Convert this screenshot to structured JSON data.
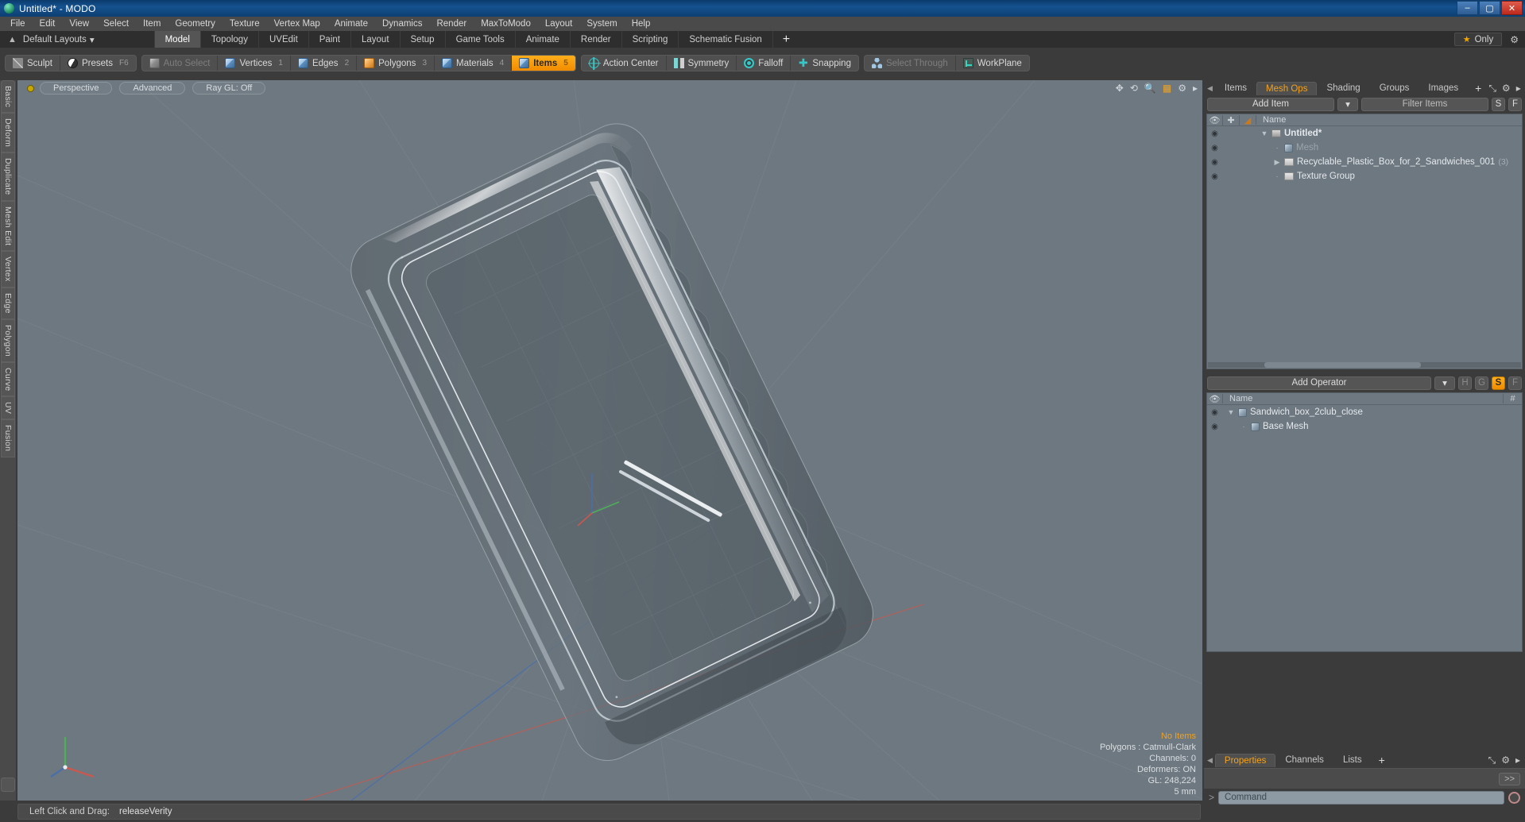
{
  "window": {
    "title": "Untitled* - MODO",
    "app_icon": "modo-logo-icon",
    "minimize": "–",
    "maximize": "▢",
    "close": "✕"
  },
  "menubar": {
    "items": [
      "File",
      "Edit",
      "View",
      "Select",
      "Item",
      "Geometry",
      "Texture",
      "Vertex Map",
      "Animate",
      "Dynamics",
      "Render",
      "MaxToModo",
      "Layout",
      "System",
      "Help"
    ]
  },
  "layoutrow": {
    "tree_icon": "tree-icon",
    "default_layouts": "Default Layouts",
    "dropdown_caret": "▾",
    "tabs": [
      {
        "label": "Model",
        "active": true
      },
      {
        "label": "Topology",
        "active": false
      },
      {
        "label": "UVEdit",
        "active": false
      },
      {
        "label": "Paint",
        "active": false
      },
      {
        "label": "Layout",
        "active": false
      },
      {
        "label": "Setup",
        "active": false
      },
      {
        "label": "Game Tools",
        "active": false
      },
      {
        "label": "Animate",
        "active": false
      },
      {
        "label": "Render",
        "active": false
      },
      {
        "label": "Scripting",
        "active": false
      },
      {
        "label": "Schematic Fusion",
        "active": false
      }
    ],
    "add_tab": "+",
    "only_label": "Only",
    "star_icon": "star-icon",
    "gear_icon": "gear-icon"
  },
  "modebar": {
    "groups": [
      {
        "buttons": [
          {
            "label": "Sculpt",
            "icon": "pen-icon",
            "state": "normal",
            "hot": ""
          },
          {
            "label": "Presets",
            "icon": "sphere-icon",
            "state": "normal",
            "hot": "F6"
          }
        ]
      },
      {
        "buttons": [
          {
            "label": "Auto Select",
            "icon": "grey-cube-icon",
            "state": "dim",
            "hot": ""
          },
          {
            "label": "Vertices",
            "icon": "blue-cube-icon",
            "state": "normal",
            "hot": "1"
          },
          {
            "label": "Edges",
            "icon": "blue-cube-icon",
            "state": "normal",
            "hot": "2"
          },
          {
            "label": "Polygons",
            "icon": "orange-cube-icon",
            "state": "normal",
            "hot": "3"
          },
          {
            "label": "Materials",
            "icon": "blue-cube-icon",
            "state": "normal",
            "hot": "4"
          },
          {
            "label": "Items",
            "icon": "blue-cube-icon",
            "state": "active",
            "hot": "5"
          }
        ]
      },
      {
        "buttons": [
          {
            "label": "Action Center",
            "icon": "target-icon",
            "state": "normal",
            "hot": ""
          },
          {
            "label": "Symmetry",
            "icon": "symmetry-icon",
            "state": "normal",
            "hot": ""
          },
          {
            "label": "Falloff",
            "icon": "falloff-icon",
            "state": "normal",
            "hot": ""
          },
          {
            "label": "Snapping",
            "icon": "snap-icon",
            "state": "normal",
            "hot": ""
          }
        ]
      },
      {
        "buttons": [
          {
            "label": "Select Through",
            "icon": "nodes-icon",
            "state": "dim",
            "hot": ""
          },
          {
            "label": "WorkPlane",
            "icon": "workplane-icon",
            "state": "normal",
            "hot": ""
          }
        ]
      }
    ]
  },
  "left_strip": {
    "tabs": [
      "Basic",
      "Deform",
      "Duplicate",
      "Mesh Edit",
      "Vertex",
      "Edge",
      "Polygon",
      "Curve",
      "UV",
      "Fusion"
    ]
  },
  "viewport": {
    "indicator_icon": "record-dot-icon",
    "pills": [
      "Perspective",
      "Advanced",
      "Ray GL: Off"
    ],
    "header_icons": [
      "move-icon",
      "rotate-icon",
      "zoom-icon",
      "grid-icon",
      "gear-icon",
      "chevron-right-icon"
    ],
    "stats": {
      "selection": "No Items",
      "polygons": "Polygons : Catmull-Clark",
      "channels": "Channels: 0",
      "deformers": "Deformers: ON",
      "gl": "GL: 248,224",
      "scale": "5 mm"
    },
    "axis_gizmo": "axis-gizmo-icon",
    "colors": {
      "x_axis": "#c9584f",
      "y_axis": "#3f7fd6",
      "z_axis": "#4fae5a",
      "background": "#6e7880"
    }
  },
  "item_panel": {
    "tabs": [
      {
        "label": "Items",
        "active": false
      },
      {
        "label": "Mesh Ops",
        "active": true
      },
      {
        "label": "Shading",
        "active": false
      },
      {
        "label": "Groups",
        "active": false
      },
      {
        "label": "Images",
        "active": false
      }
    ],
    "add_tab": "+",
    "tools": [
      "expand-icon",
      "gear-icon",
      "chevron-right-icon"
    ],
    "add_item_label": "Add Item",
    "add_item_caret": "▾",
    "filter_placeholder": "Filter Items",
    "btn_s": "S",
    "btn_f": "F",
    "columns": {
      "eye": "eye-icon",
      "lock": "lock-icon",
      "shade": "shade-icon",
      "name": "Name"
    },
    "rows": [
      {
        "name": "Untitled*",
        "icon": "scene-icon",
        "indent": 0,
        "twisty": "▼",
        "bold": true,
        "dim": false,
        "count": ""
      },
      {
        "name": "Mesh",
        "icon": "mesh-cube-icon",
        "indent": 1,
        "twisty": "",
        "bold": false,
        "dim": true,
        "count": ""
      },
      {
        "name": "Recyclable_Plastic_Box_for_2_Sandwiches_001",
        "icon": "folder-icon",
        "indent": 1,
        "twisty": "▶",
        "bold": false,
        "dim": false,
        "count": "(3)"
      },
      {
        "name": "Texture Group",
        "icon": "folder-icon",
        "indent": 1,
        "twisty": "",
        "bold": false,
        "dim": false,
        "count": ""
      }
    ]
  },
  "meshops_panel": {
    "add_operator_label": "Add Operator",
    "add_operator_caret": "▾",
    "buttons": [
      {
        "label": "H",
        "active": false
      },
      {
        "label": "G",
        "active": false
      },
      {
        "label": "S",
        "active": true
      },
      {
        "label": "F",
        "active": false
      }
    ],
    "columns": {
      "eye": "eye-icon",
      "name": "Name",
      "hash": "#"
    },
    "rows": [
      {
        "name": "Sandwich_box_2club_close",
        "icon": "mesh-cube-icon",
        "indent": 0,
        "twisty": "▼"
      },
      {
        "name": "Base Mesh",
        "icon": "mesh-cube-icon",
        "indent": 1,
        "twisty": ""
      }
    ]
  },
  "properties_panel": {
    "tabs": [
      {
        "label": "Properties",
        "active": true
      },
      {
        "label": "Channels",
        "active": false
      },
      {
        "label": "Lists",
        "active": false
      }
    ],
    "add_tab": "+",
    "tools": [
      "expand-icon",
      "gear-icon",
      "chevron-right-icon"
    ],
    "forward_button": ">>"
  },
  "command_bar": {
    "prompt": ">",
    "placeholder": "Command",
    "record_icon": "record-icon"
  },
  "statusbar": {
    "hint_label": "Left Click and Drag:",
    "hint_value": "releaseVerity"
  }
}
